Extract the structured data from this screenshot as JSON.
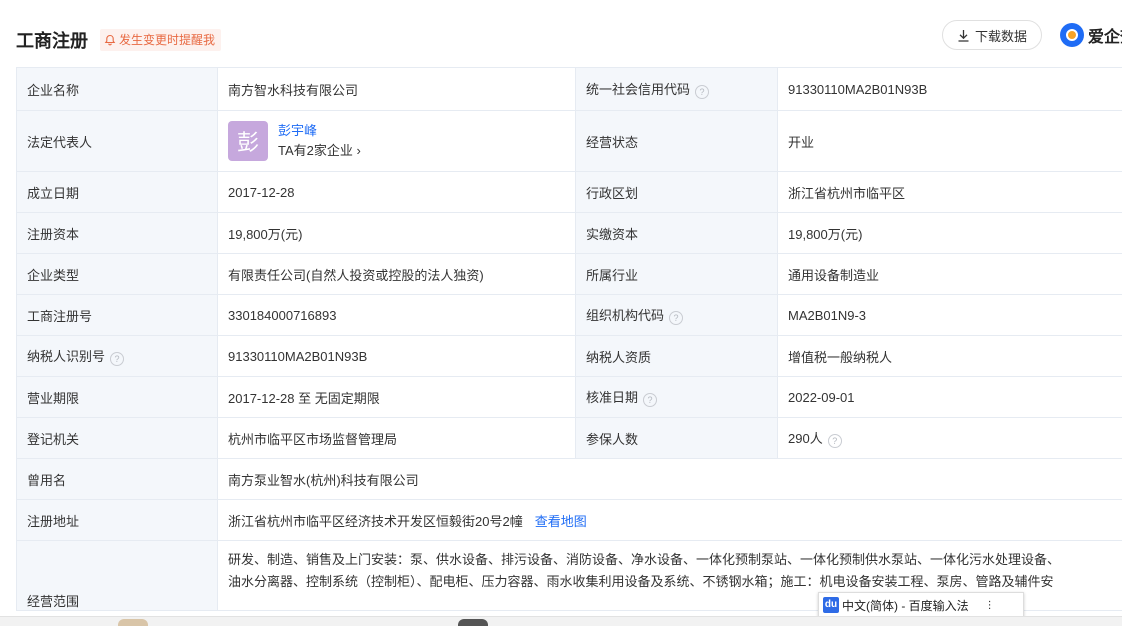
{
  "header": {
    "title": "工商注册",
    "remind_label": "发生变更时提醒我",
    "download_label": "下载数据",
    "brand_text": "爱企查"
  },
  "rows": {
    "company_name": {
      "label": "企业名称",
      "value": "南方智水科技有限公司"
    },
    "credit_code": {
      "label": "统一社会信用代码",
      "value": "91330110MA2B01N93B"
    },
    "legal_rep": {
      "label": "法定代表人",
      "avatar_char": "彭",
      "name": "彭宇峰",
      "companies": "TA有2家企业"
    },
    "status": {
      "label": "经营状态",
      "value": "开业"
    },
    "found_date": {
      "label": "成立日期",
      "value": "2017-12-28"
    },
    "region": {
      "label": "行政区划",
      "value": "浙江省杭州市临平区"
    },
    "reg_capital": {
      "label": "注册资本",
      "value": "19,800万(元)"
    },
    "paid_capital": {
      "label": "实缴资本",
      "value": "19,800万(元)"
    },
    "company_type": {
      "label": "企业类型",
      "value": "有限责任公司(自然人投资或控股的法人独资)"
    },
    "industry": {
      "label": "所属行业",
      "value": "通用设备制造业"
    },
    "reg_number": {
      "label": "工商注册号",
      "value": "330184000716893"
    },
    "org_code": {
      "label": "组织机构代码",
      "value": "MA2B01N9-3"
    },
    "taxpayer_id": {
      "label": "纳税人识别号",
      "value": "91330110MA2B01N93B"
    },
    "taxpayer_qual": {
      "label": "纳税人资质",
      "value": "增值税一般纳税人"
    },
    "term": {
      "label": "营业期限",
      "value": "2017-12-28 至 无固定期限"
    },
    "approve_date": {
      "label": "核准日期",
      "value": "2022-09-01"
    },
    "authority": {
      "label": "登记机关",
      "value": "杭州市临平区市场监督管理局"
    },
    "insured": {
      "label": "参保人数",
      "value": "290人"
    },
    "former_name": {
      "label": "曾用名",
      "value": "南方泵业智水(杭州)科技有限公司"
    },
    "address": {
      "label": "注册地址",
      "value": "浙江省杭州市临平区经济技术开发区恒毅街20号2幢",
      "map_link": "查看地图"
    },
    "scope": {
      "label": "经营范围",
      "line1": "研发、制造、销售及上门安装：泵、供水设备、排污设备、消防设备、净水设备、一体化预制泵站、一体化预制供水泵站、一体化污水处理设备、",
      "line2": "油水分离器、控制系统（控制柜）、配电柜、压力容器、雨水收集利用设备及系统、不锈钢水箱；施工：机电设备安装工程、泵房、管路及辅件安"
    }
  },
  "ime": {
    "badge": "du",
    "text": "中文(简体) - 百度输入法"
  },
  "colors": {
    "accent": "#1f6cf5",
    "remind": "#e86a43",
    "label_bg": "#f4f7fb"
  }
}
